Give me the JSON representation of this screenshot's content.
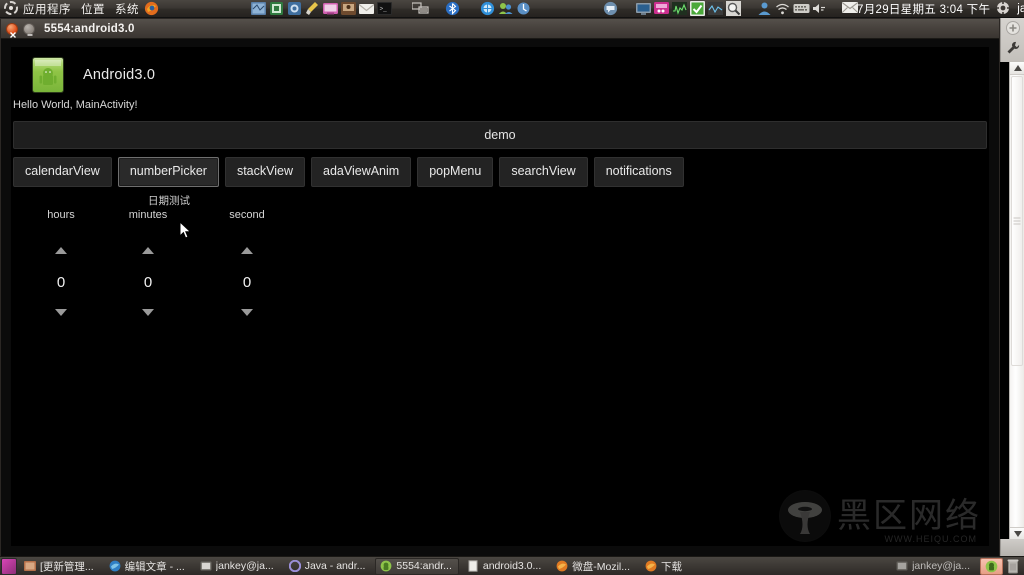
{
  "top_panel": {
    "menus": [
      "应用程序",
      "位置",
      "系统"
    ],
    "icons_left": [
      "ubuntu-logo-icon",
      "firefox-icon",
      "network-map-icon",
      "package-icon",
      "printer-icon",
      "broom-icon",
      "display-icon",
      "messenger-icon",
      "mail-icon",
      "terminal-icon",
      "workspace-switcher-icon",
      "bluetooth-icon",
      "browser-globe-icon",
      "users-icon",
      "update-icon"
    ],
    "icons_right": [
      "chat-icon",
      "monitor-icon",
      "pink-tool-icon",
      "system-monitor-icon",
      "checkmark-icon",
      "graph-icon",
      "search-magnifier-icon",
      "user-icon",
      "wifi-icon",
      "keyboard-icon",
      "volume-icon",
      "mail-envelope-icon"
    ],
    "clock": "7月29日星期五  3:04 下午",
    "user": "jankey",
    "power_icon": "power-icon"
  },
  "window": {
    "title": "5554:android3.0",
    "close_icon": "close-icon",
    "minimize_icon": "minimize-icon"
  },
  "android": {
    "app_icon": "android-app-icon",
    "app_title": "Android3.0",
    "hello_text": "Hello World, MainActivity!",
    "demo_label": "demo",
    "buttons": [
      {
        "label": "calendarView",
        "focused": false
      },
      {
        "label": "numberPicker",
        "focused": true
      },
      {
        "label": "stackView",
        "focused": false
      },
      {
        "label": "adaViewAnim",
        "focused": false
      },
      {
        "label": "popMenu",
        "focused": false
      },
      {
        "label": "searchView",
        "focused": false
      },
      {
        "label": "notifications",
        "focused": false
      }
    ],
    "picker": {
      "title": "日期测试",
      "columns": [
        {
          "label": "hours",
          "value": "0",
          "up_icon": "chevron-up-icon",
          "down_icon": "chevron-down-icon"
        },
        {
          "label": "minutes",
          "value": "0",
          "up_icon": "chevron-up-icon",
          "down_icon": "chevron-down-icon"
        },
        {
          "label": "second",
          "value": "0",
          "up_icon": "chevron-up-icon",
          "down_icon": "chevron-down-icon"
        }
      ]
    },
    "watermark": {
      "text": "黑区网络",
      "sub": "WWW.HEIQU.COM",
      "logo_icon": "mushroom-logo-icon"
    }
  },
  "scrollbar": {
    "up_icon": "scroll-up-icon",
    "down_icon": "scroll-down-icon",
    "tool_icon": "wrench-icon",
    "zoom_icon": "zoom-in-icon"
  },
  "taskbar": {
    "show_desktop_icon": "show-desktop-icon",
    "items": [
      {
        "label": "[更新管理...",
        "icon": "update-manager-icon",
        "active": false
      },
      {
        "label": "编辑文章 - ...",
        "icon": "firefox-icon",
        "active": false
      },
      {
        "label": "jankey@ja...",
        "icon": "terminal-icon",
        "active": false
      },
      {
        "label": "Java - andr...",
        "icon": "eclipse-icon",
        "active": false
      },
      {
        "label": "5554:andr...",
        "icon": "android-icon",
        "active": true
      },
      {
        "label": "android3.0...",
        "icon": "document-icon",
        "active": false
      },
      {
        "label": "微盘-Mozil...",
        "icon": "firefox-icon",
        "active": false
      },
      {
        "label": "下载",
        "icon": "firefox-icon",
        "active": false
      },
      {
        "label": "jankey@ja...",
        "icon": "terminal-icon",
        "active": false
      }
    ],
    "trash_icon": "trash-icon"
  },
  "colors": {
    "panel": "#3b3733",
    "window_title": "#46413c",
    "accent_close": "#dd4814",
    "android_bg": "#000000",
    "button_bg": "#232323",
    "focus_border": "#6f6f6f"
  }
}
